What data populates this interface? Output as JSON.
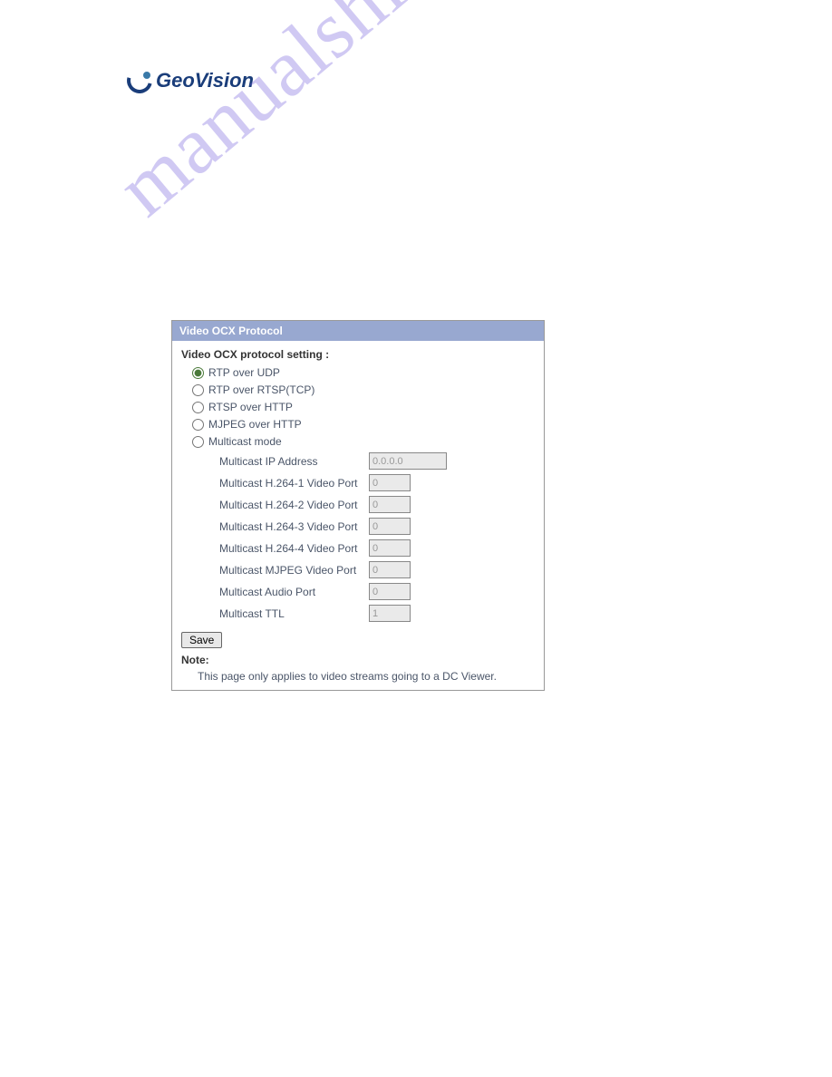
{
  "logo": {
    "text_geo": "Geo",
    "text_vision": "Vision"
  },
  "panel": {
    "header": "Video OCX Protocol",
    "section_title": "Video OCX protocol setting :",
    "options": {
      "rtp_udp": "RTP over UDP",
      "rtp_rtsp": "RTP over RTSP(TCP)",
      "rtsp_http": "RTSP over HTTP",
      "mjpeg_http": "MJPEG over HTTP",
      "multicast": "Multicast mode"
    },
    "fields": {
      "ip_label": "Multicast IP Address",
      "ip_value": "0.0.0.0",
      "h264_1_label": "Multicast H.264-1 Video Port",
      "h264_1_value": "0",
      "h264_2_label": "Multicast H.264-2 Video Port",
      "h264_2_value": "0",
      "h264_3_label": "Multicast H.264-3 Video Port",
      "h264_3_value": "0",
      "h264_4_label": "Multicast H.264-4 Video Port",
      "h264_4_value": "0",
      "mjpeg_label": "Multicast MJPEG Video Port",
      "mjpeg_value": "0",
      "audio_label": "Multicast Audio Port",
      "audio_value": "0",
      "ttl_label": "Multicast TTL",
      "ttl_value": "1"
    },
    "save_label": "Save",
    "note_label": "Note:",
    "note_text": "This page only applies to video streams going to a DC Viewer."
  },
  "watermark": "manualshive.com"
}
